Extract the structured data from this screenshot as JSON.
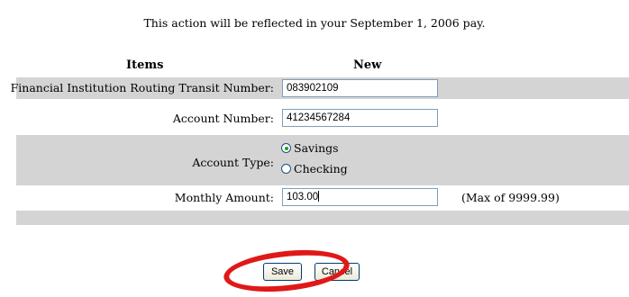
{
  "notice": "This action will be reflected in your  September 1, 2006 pay.",
  "headers": {
    "items": "Items",
    "new": "New"
  },
  "routing": {
    "label": "Financial Institution Routing Transit Number:",
    "value": "083902109"
  },
  "account_number": {
    "label": "Account Number:",
    "value": "41234567284"
  },
  "account_type": {
    "label": "Account Type:",
    "options": [
      "Savings",
      "Checking"
    ],
    "selected": "Savings"
  },
  "monthly_amount": {
    "label": "Monthly Amount:",
    "value": "103.00",
    "hint": "(Max of 9999.99)"
  },
  "buttons": {
    "save": "Save",
    "cancel": "Cancel"
  },
  "colors": {
    "row_gray": "#d4d4d4",
    "annotation_ring": "#e01818"
  }
}
